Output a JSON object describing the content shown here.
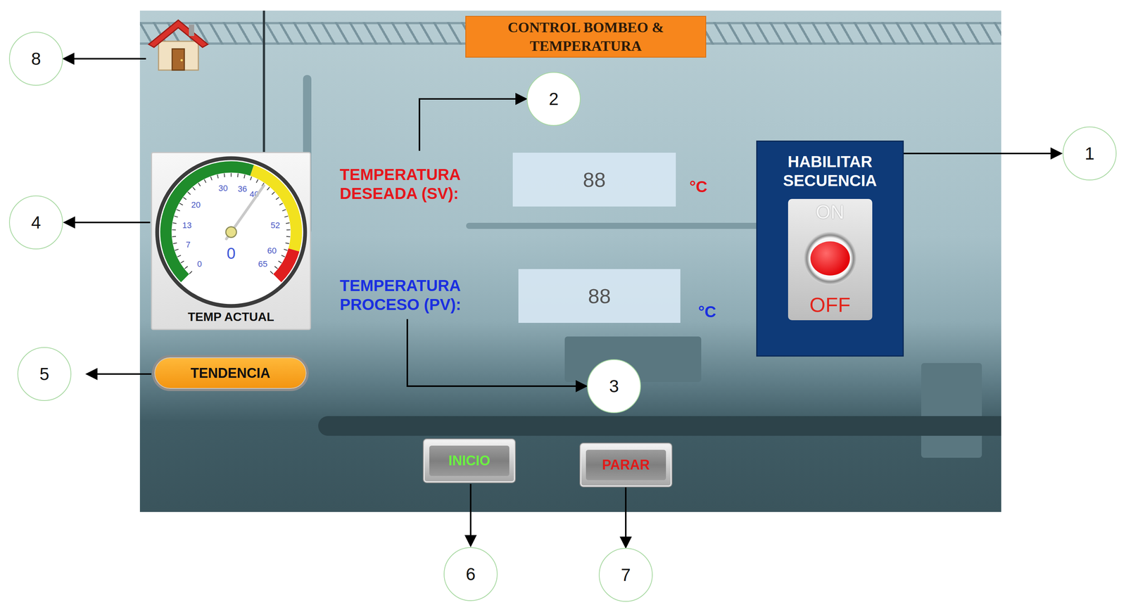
{
  "screen": {
    "title": [
      "CONTROL BOMBEO &",
      "TEMPERATURA"
    ]
  },
  "gauge": {
    "label": "TEMP ACTUAL",
    "value": "0",
    "level": 0.63,
    "ticks": [
      {
        "text": "0",
        "value": 0
      },
      {
        "text": "7",
        "value": 7
      },
      {
        "text": "13",
        "value": 13
      },
      {
        "text": "20",
        "value": 20
      },
      {
        "text": "30",
        "value": 30
      },
      {
        "text": "36",
        "value": 36
      },
      {
        "text": "40",
        "value": 40
      },
      {
        "text": "52",
        "value": 52
      },
      {
        "text": "60",
        "value": 60
      },
      {
        "text": "65",
        "value": 65
      }
    ],
    "zones": [
      {
        "from": 0,
        "to": 37,
        "color": "#1f8c2b"
      },
      {
        "from": 37,
        "to": 58,
        "color": "#f2e21f"
      },
      {
        "from": 58,
        "to": 65,
        "color": "#e01e1e"
      }
    ]
  },
  "trend_button": {
    "label": "TENDENCIA"
  },
  "setpoint": {
    "label": [
      "TEMPERATURA",
      "DESEADA (SV):"
    ],
    "value": "88",
    "unit": "°C"
  },
  "process": {
    "label": [
      "TEMPERATURA",
      "PROCESO (PV):"
    ],
    "value": "88",
    "unit": "°C"
  },
  "sequence": {
    "label": [
      "HABILITAR",
      "SECUENCIA"
    ],
    "on_text": "ON",
    "off_text": "OFF",
    "on": false
  },
  "buttons": [
    {
      "label": "INICIO",
      "color": "#6cf042"
    },
    {
      "label": "PARAR",
      "color": "#e01b1b"
    }
  ],
  "callouts": [
    {
      "number": "1"
    },
    {
      "number": "2"
    },
    {
      "number": "3"
    },
    {
      "number": "4"
    },
    {
      "number": "5"
    },
    {
      "number": "6"
    },
    {
      "number": "7"
    },
    {
      "number": "8"
    }
  ]
}
